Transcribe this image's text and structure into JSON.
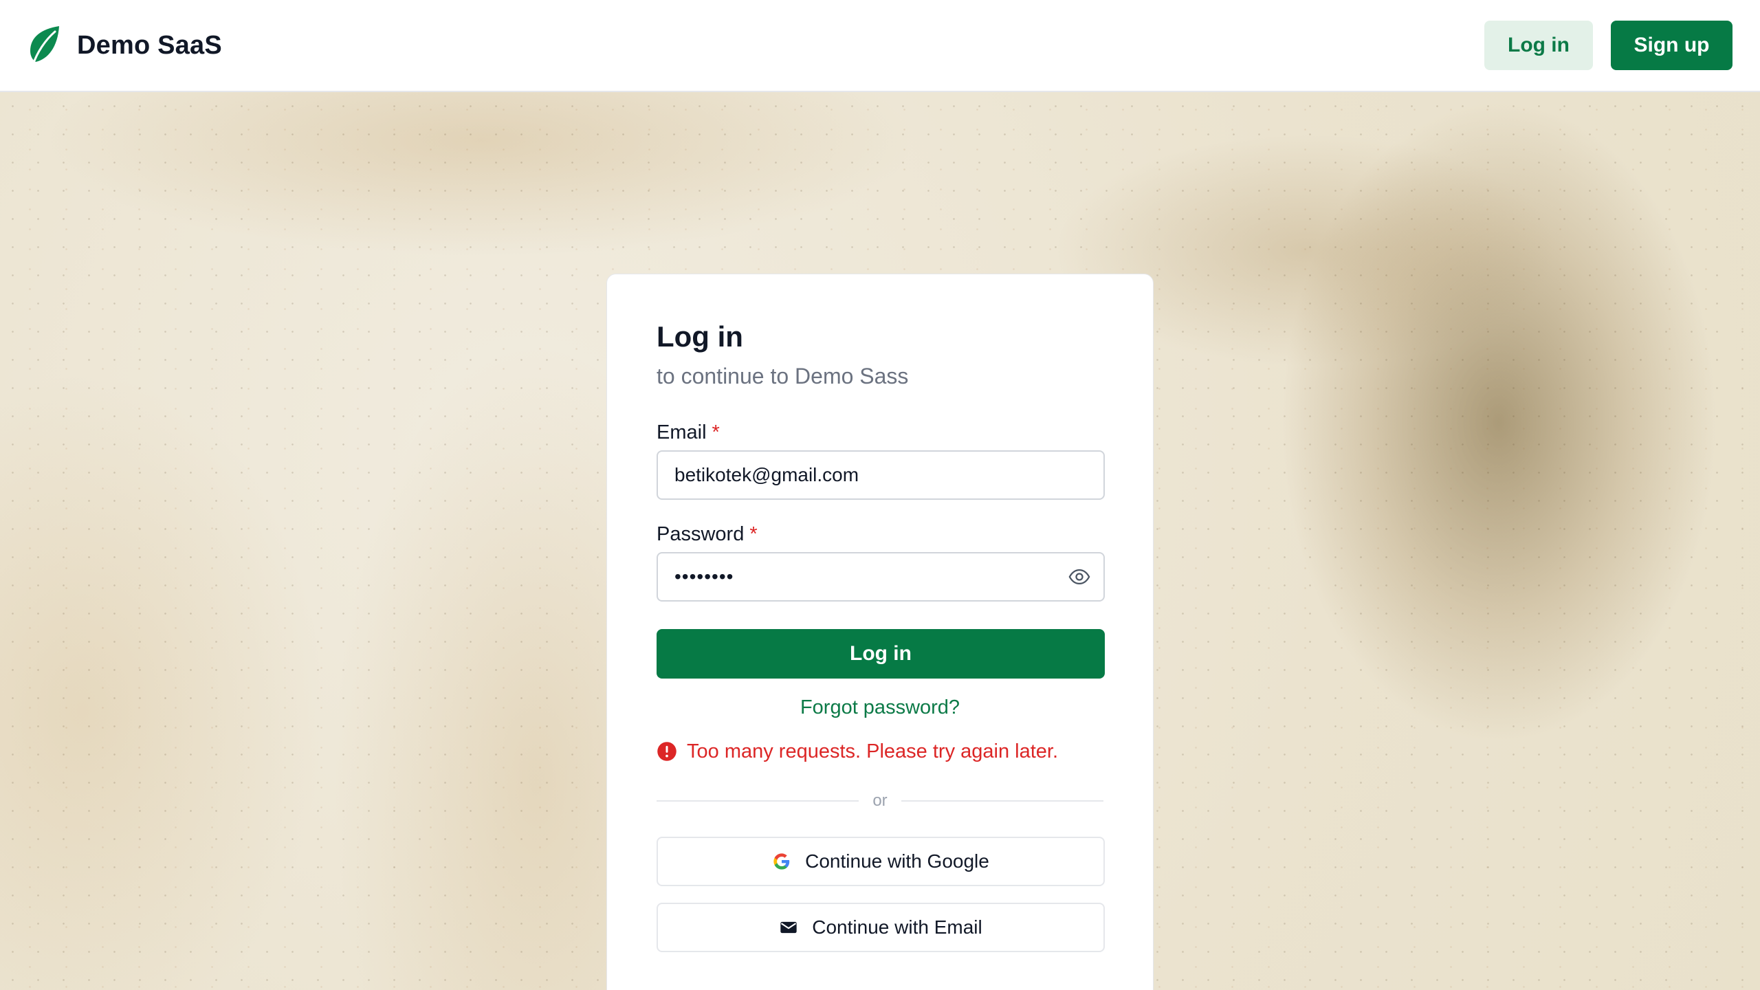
{
  "header": {
    "brand_name": "Demo SaaS",
    "login_label": "Log in",
    "signup_label": "Sign up"
  },
  "card": {
    "title": "Log in",
    "subtitle": "to continue to Demo Sass",
    "email_label": "Email",
    "email_required_mark": "*",
    "email_value": "betikotek@gmail.com",
    "password_label": "Password",
    "password_required_mark": "*",
    "password_value": "••••••••",
    "login_button": "Log in",
    "forgot_link": "Forgot password?",
    "error_message": "Too many requests. Please try again later.",
    "divider_text": "or",
    "google_button": "Continue with Google",
    "email_button": "Continue with Email"
  },
  "colors": {
    "primary": "#067a45",
    "primary_light": "#e3f1e8",
    "error": "#dc2626",
    "muted_text": "#6b7280"
  },
  "icons": {
    "brand": "leaf-icon",
    "password_toggle": "eye-icon",
    "error": "alert-circle-icon",
    "google": "google-icon",
    "email": "mail-icon"
  }
}
